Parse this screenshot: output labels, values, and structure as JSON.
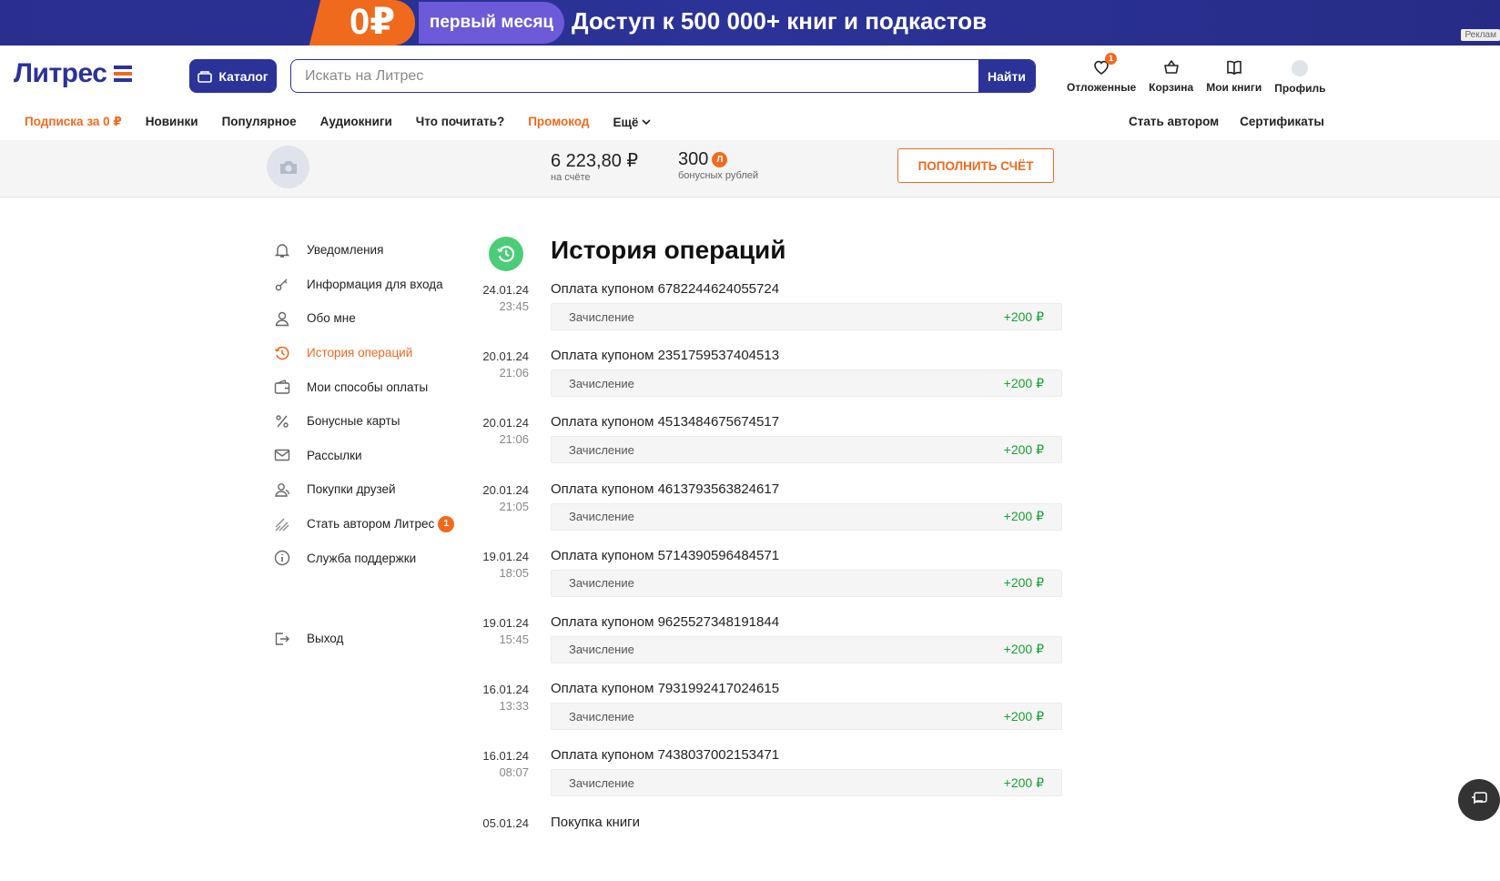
{
  "banner": {
    "zero": "0₽",
    "first_month": "первый месяц",
    "access": "Доступ к 500 000+ книг и подкастов",
    "ad": "Реклам"
  },
  "header": {
    "logo": "Литрес",
    "catalog_label": "Каталог",
    "search_placeholder": "Искать на Литрес",
    "search_button": "Найти",
    "nav": [
      {
        "label": "Отложенные",
        "icon": "heart-icon",
        "badge": "1"
      },
      {
        "label": "Корзина",
        "icon": "basket-icon"
      },
      {
        "label": "Мои книги",
        "icon": "book-icon"
      },
      {
        "label": "Профиль",
        "icon": "avatar"
      }
    ]
  },
  "menu": {
    "items": [
      "Подписка за 0 ₽",
      "Новинки",
      "Популярное",
      "Аудиокниги",
      "Что почитать?",
      "Промокод",
      "Ещё"
    ],
    "right": [
      "Стать автором",
      "Сертификаты"
    ]
  },
  "account": {
    "balance": "6 223,80 ₽",
    "balance_label": "на счёте",
    "bonus": "300",
    "bonus_badge": "Л",
    "bonus_label": "бонусных рублей",
    "topup": "ПОПОЛНИТЬ СЧЁТ"
  },
  "sidebar": {
    "items": [
      {
        "label": "Уведомления",
        "icon": "bell-icon"
      },
      {
        "label": "Информация для входа",
        "icon": "key-icon"
      },
      {
        "label": "Обо мне",
        "icon": "user-icon"
      },
      {
        "label": "История операций",
        "icon": "history-icon",
        "active": true
      },
      {
        "label": "Мои способы оплаты",
        "icon": "wallet-icon"
      },
      {
        "label": "Бонусные карты",
        "icon": "percent-icon"
      },
      {
        "label": "Рассылки",
        "icon": "mail-icon"
      },
      {
        "label": "Покупки друзей",
        "icon": "users-icon"
      },
      {
        "label": "Стать автором Литрес",
        "icon": "pen-icon",
        "badge": "1"
      },
      {
        "label": "Служба поддержки",
        "icon": "info-icon"
      }
    ],
    "exit": "Выход"
  },
  "page_title": "История операций",
  "operations": [
    {
      "date": "24.01.24",
      "time": "23:45",
      "desc": "Оплата купоном 6782244624055724",
      "type": "Зачисление",
      "amount": "+200 ₽"
    },
    {
      "date": "20.01.24",
      "time": "21:06",
      "desc": "Оплата купоном 2351759537404513",
      "type": "Зачисление",
      "amount": "+200 ₽"
    },
    {
      "date": "20.01.24",
      "time": "21:06",
      "desc": "Оплата купоном 4513484675674517",
      "type": "Зачисление",
      "amount": "+200 ₽"
    },
    {
      "date": "20.01.24",
      "time": "21:05",
      "desc": "Оплата купоном 4613793563824617",
      "type": "Зачисление",
      "amount": "+200 ₽"
    },
    {
      "date": "19.01.24",
      "time": "18:05",
      "desc": "Оплата купоном 5714390596484571",
      "type": "Зачисление",
      "amount": "+200 ₽"
    },
    {
      "date": "19.01.24",
      "time": "15:45",
      "desc": "Оплата купоном 9625527348191844",
      "type": "Зачисление",
      "amount": "+200 ₽"
    },
    {
      "date": "16.01.24",
      "time": "13:33",
      "desc": "Оплата купоном 7931992417024615",
      "type": "Зачисление",
      "amount": "+200 ₽"
    },
    {
      "date": "16.01.24",
      "time": "08:07",
      "desc": "Оплата купоном 7438037002153471",
      "type": "Зачисление",
      "amount": "+200 ₽"
    },
    {
      "date": "05.01.24",
      "time": "",
      "desc": "Покупка книги",
      "type": "",
      "amount": ""
    }
  ],
  "colors": {
    "brand": "#2b3398",
    "accent": "#f06a1d",
    "positive": "#18a033"
  }
}
